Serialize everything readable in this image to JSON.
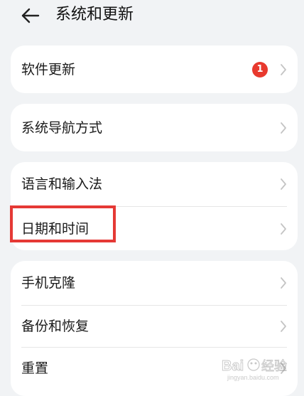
{
  "header": {
    "title": "系统和更新",
    "back_icon": "arrow-left-icon"
  },
  "cards": [
    {
      "items": [
        {
          "label": "软件更新",
          "badge": "1"
        }
      ]
    },
    {
      "items": [
        {
          "label": "系统导航方式"
        }
      ]
    },
    {
      "items": [
        {
          "label": "语言和输入法"
        },
        {
          "label": "日期和时间"
        }
      ]
    },
    {
      "items": [
        {
          "label": "手机克隆"
        },
        {
          "label": "备份和恢复"
        },
        {
          "label": "重置"
        }
      ]
    }
  ],
  "colors": {
    "background": "#f1f3f5",
    "card": "#ffffff",
    "badge": "#e8392e",
    "highlight": "#e53935"
  },
  "watermark": {
    "text": "Bai 经验",
    "subtext": "jingyan.baidu.com"
  }
}
